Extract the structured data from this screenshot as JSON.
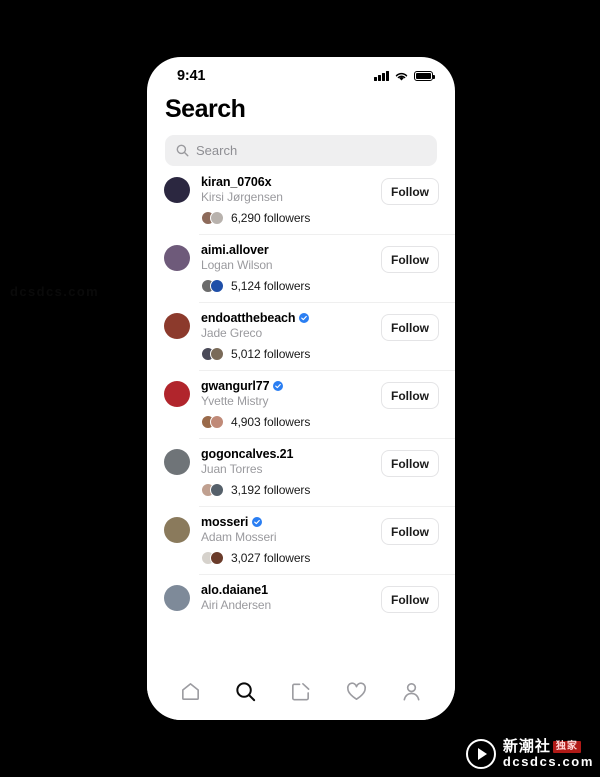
{
  "statusbar": {
    "time": "9:41",
    "signal_icon": "cellular-bars-icon",
    "wifi_icon": "wifi-icon",
    "battery_icon": "battery-icon"
  },
  "header": {
    "title": "Search"
  },
  "search": {
    "placeholder": "Search",
    "value": "",
    "icon": "search-icon"
  },
  "follow_label": "Follow",
  "accounts": [
    {
      "username": "kiran_0706x",
      "fullname": "Kirsi Jørgensen",
      "verified": false,
      "followers": "6,290 followers",
      "avatar_color": "#2b2740",
      "mutual_colors": [
        "#8d6a5a",
        "#b8b2ad"
      ]
    },
    {
      "username": "aimi.allover",
      "fullname": "Logan Wilson",
      "verified": false,
      "followers": "5,124 followers",
      "avatar_color": "#6e5a7a",
      "mutual_colors": [
        "#6b6b6b",
        "#1f4fa8"
      ]
    },
    {
      "username": "endoatthebeach",
      "fullname": "Jade Greco",
      "verified": true,
      "followers": "5,012 followers",
      "avatar_color": "#8c3a2c",
      "mutual_colors": [
        "#4a4a58",
        "#7a6a58"
      ]
    },
    {
      "username": "gwangurl77",
      "fullname": "Yvette Mistry",
      "verified": true,
      "followers": "4,903 followers",
      "avatar_color": "#b1252c",
      "mutual_colors": [
        "#9a6a4a",
        "#c08a78"
      ]
    },
    {
      "username": "gogoncalves.21",
      "fullname": "Juan Torres",
      "verified": false,
      "followers": "3,192 followers",
      "avatar_color": "#6f7478",
      "mutual_colors": [
        "#c0a090",
        "#55606a"
      ]
    },
    {
      "username": "mosseri",
      "fullname": "Adam Mosseri",
      "verified": true,
      "followers": "3,027 followers",
      "avatar_color": "#8a7a5c",
      "mutual_colors": [
        "#d6d2cc",
        "#6a3b2a"
      ]
    },
    {
      "username": "alo.daiane1",
      "fullname": "Airi Andersen",
      "verified": false,
      "followers": "",
      "avatar_color": "#7e8a99",
      "mutual_colors": []
    }
  ],
  "tabbar": [
    {
      "name": "home-icon",
      "active": false
    },
    {
      "name": "search-icon",
      "active": true
    },
    {
      "name": "compose-icon",
      "active": false
    },
    {
      "name": "heart-icon",
      "active": false
    },
    {
      "name": "profile-icon",
      "active": false
    }
  ],
  "watermark": {
    "brand": "新潮社",
    "stamp": "独家",
    "url": "dcsdcs.com",
    "left_url": "dcsdcs.com",
    "play_icon": "play-icon"
  },
  "colors": {
    "verified_blue": "#2a7ef2",
    "accent_red": "#b01a17",
    "bg": "#000000",
    "surface": "#ffffff",
    "field": "#efeff0"
  }
}
